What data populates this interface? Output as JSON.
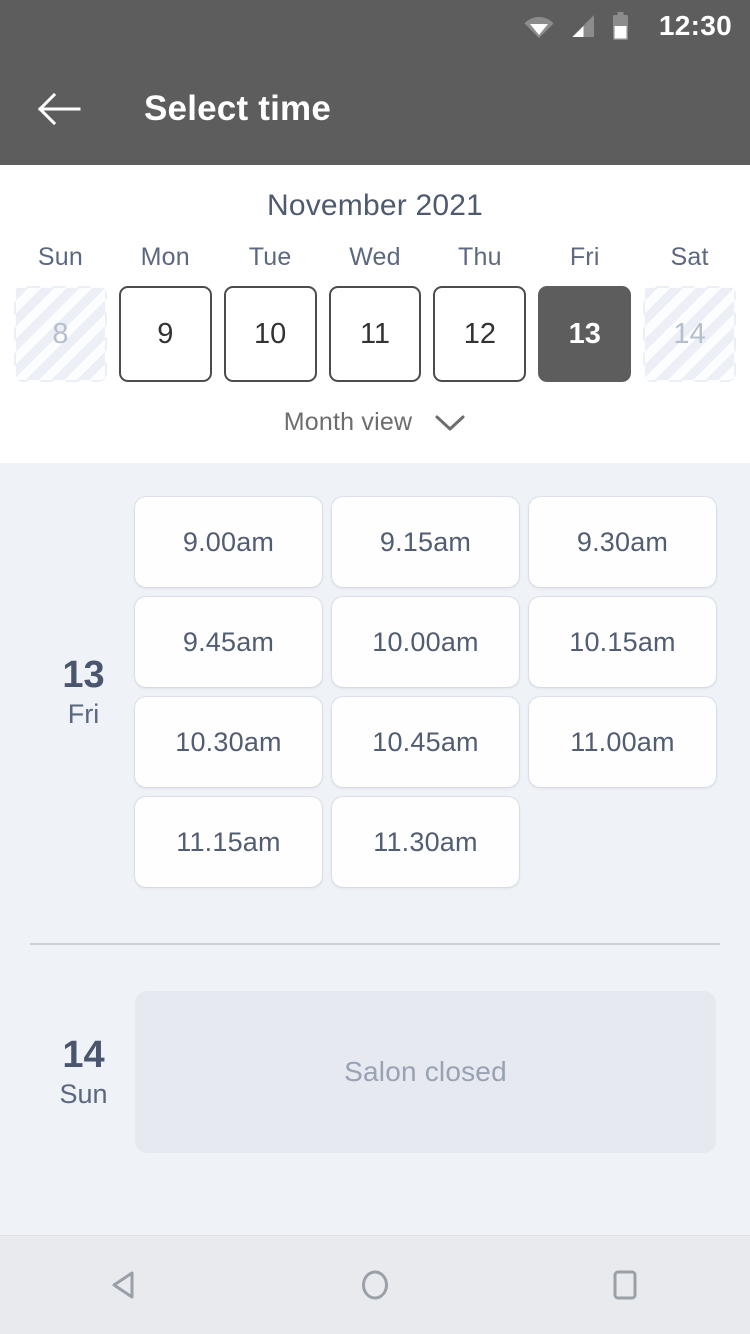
{
  "status_bar": {
    "time": "12:30",
    "icons": [
      "wifi-icon",
      "signal-icon",
      "battery-icon"
    ]
  },
  "app_bar": {
    "back_icon": "arrow-left-icon",
    "title": "Select time"
  },
  "calendar": {
    "month_title": "November 2021",
    "weekdays": [
      "Sun",
      "Mon",
      "Tue",
      "Wed",
      "Thu",
      "Fri",
      "Sat"
    ],
    "days": [
      {
        "num": "8",
        "state": "disabled"
      },
      {
        "num": "9",
        "state": "available"
      },
      {
        "num": "10",
        "state": "available"
      },
      {
        "num": "11",
        "state": "available"
      },
      {
        "num": "12",
        "state": "available"
      },
      {
        "num": "13",
        "state": "selected"
      },
      {
        "num": "14",
        "state": "disabled"
      }
    ],
    "month_view_label": "Month view",
    "month_view_icon": "chevron-down-icon"
  },
  "schedule": {
    "days": [
      {
        "date_num": "13",
        "date_dow": "Fri",
        "slots": [
          "9.00am",
          "9.15am",
          "9.30am",
          "9.45am",
          "10.00am",
          "10.15am",
          "10.30am",
          "10.45am",
          "11.00am",
          "11.15am",
          "11.30am"
        ]
      },
      {
        "date_num": "14",
        "date_dow": "Sun",
        "closed_message": "Salon closed"
      }
    ]
  },
  "nav_bar": {
    "back": "nav-back-icon",
    "home": "nav-home-icon",
    "recents": "nav-recents-icon"
  },
  "colors": {
    "header_bg": "#5d5d5d",
    "page_bg": "#eff2f7",
    "card_bg": "#fefefe",
    "text_primary": "#4a566e",
    "text_muted": "#98a2b3",
    "selected_day": "#5d5d5d",
    "nav_bg": "#e8eaee"
  }
}
